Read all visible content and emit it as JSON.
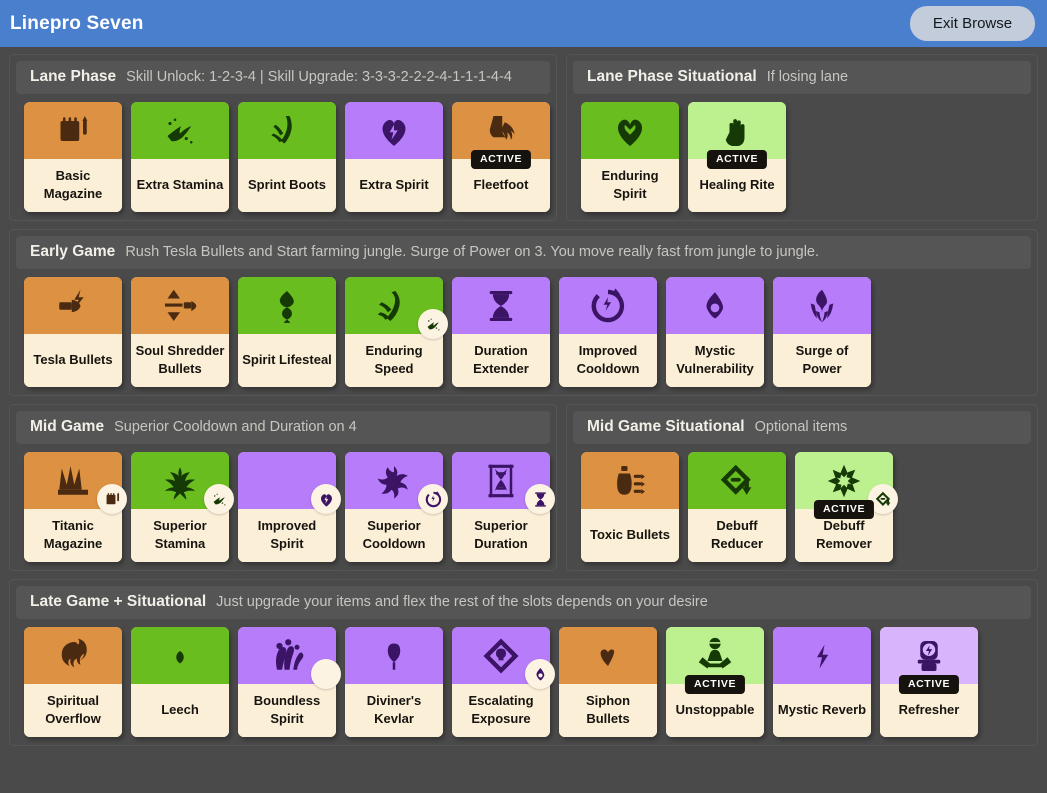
{
  "header": {
    "title": "Linepro Seven",
    "exit_label": "Exit Browse",
    "accent_color": "#4a7fce",
    "exit_button_color": "#c3ccda"
  },
  "colors": {
    "page_background": "#4a4a4a",
    "panel_background": "#4a4a4a",
    "panel_header": "#555555",
    "card_body": "#fcefd8",
    "weapon": "#dd9142",
    "vitality": "#69bd1e",
    "vitality_light": "#bdf18f",
    "spirit": "#b67cf9",
    "spirit_light": "#d8b4fd",
    "active_badge": "#16120d"
  },
  "active_badge_label": "ACTIVE",
  "sections": [
    {
      "id": "lane-phase",
      "title": "Lane Phase",
      "note": "Skill Unlock: 1-2-3-4 | Skill Upgrade: 3-3-3-2-2-2-4-1-1-1-4-4",
      "cards": [
        {
          "label": "Basic Magazine",
          "category": "weapon",
          "icon": "magazine-icon",
          "active": false,
          "tier_badge": null
        },
        {
          "label": "Extra Stamina",
          "category": "vitality",
          "icon": "stamina-icon",
          "active": false,
          "tier_badge": null
        },
        {
          "label": "Sprint Boots",
          "category": "vitality",
          "icon": "sprint-boots-icon",
          "active": false,
          "tier_badge": null
        },
        {
          "label": "Extra Spirit",
          "category": "spirit",
          "icon": "spirit-heart-icon",
          "active": false,
          "tier_badge": null
        },
        {
          "label": "Fleetfoot",
          "category": "weapon",
          "icon": "fleetfoot-boot-icon",
          "active": true,
          "tier_badge": null
        }
      ]
    },
    {
      "id": "lane-phase-situational",
      "title": "Lane Phase Situational",
      "note": "If losing lane",
      "cards": [
        {
          "label": "Enduring Spirit",
          "category": "vitality",
          "icon": "enduring-heart-icon",
          "active": false,
          "tier_badge": null
        },
        {
          "label": "Healing Rite",
          "category": "vitality_light",
          "icon": "healing-hand-icon",
          "active": true,
          "tier_badge": null
        }
      ]
    },
    {
      "id": "early-game",
      "title": "Early Game",
      "note": "Rush Tesla Bullets and Start farming jungle. Surge of Power on 3. You move really fast from jungle to jungle.",
      "cards": [
        {
          "label": "Tesla Bullets",
          "category": "weapon",
          "icon": "tesla-bullet-icon",
          "active": false,
          "tier_badge": null
        },
        {
          "label": "Soul Shredder Bullets",
          "category": "weapon",
          "icon": "soul-shredder-icon",
          "active": false,
          "tier_badge": null
        },
        {
          "label": "Spirit Lifesteal",
          "category": "vitality",
          "icon": "spirit-lifesteal-icon",
          "active": false,
          "tier_badge": null
        },
        {
          "label": "Enduring Speed",
          "category": "vitality",
          "icon": "enduring-speed-icon",
          "active": false,
          "tier_badge": "stamina-icon"
        },
        {
          "label": "Duration Extender",
          "category": "spirit",
          "icon": "hourglass-icon",
          "active": false,
          "tier_badge": null
        },
        {
          "label": "Improved Cooldown",
          "category": "spirit",
          "icon": "cooldown-icon",
          "active": false,
          "tier_badge": null
        },
        {
          "label": "Mystic Vulnerability",
          "category": "spirit",
          "icon": "mystic-vuln-icon",
          "active": false,
          "tier_badge": null
        },
        {
          "label": "Surge of Power",
          "category": "spirit",
          "icon": "surge-of-power-icon",
          "active": false,
          "tier_badge": null
        }
      ]
    },
    {
      "id": "mid-game",
      "title": "Mid Game",
      "note": "Superior Cooldown and Duration on 4",
      "cards": [
        {
          "label": "Titanic Magazine",
          "category": "weapon",
          "icon": "titanic-magazine-icon",
          "active": false,
          "tier_badge": "magazine-icon"
        },
        {
          "label": "Superior Stamina",
          "category": "vitality",
          "icon": "superior-stamina-icon",
          "active": false,
          "tier_badge": "stamina-icon"
        },
        {
          "label": "Improved Spirit",
          "category": "spirit",
          "icon": "improved-spirit-icon",
          "active": false,
          "tier_badge": "spirit-heart-icon"
        },
        {
          "label": "Superior Cooldown",
          "category": "spirit",
          "icon": "superior-cooldown-icon",
          "active": false,
          "tier_badge": "cooldown-icon"
        },
        {
          "label": "Superior Duration",
          "category": "spirit",
          "icon": "superior-duration-icon",
          "active": false,
          "tier_badge": "hourglass-icon"
        }
      ]
    },
    {
      "id": "mid-game-situational",
      "title": "Mid Game Situational",
      "note": "Optional items",
      "cards": [
        {
          "label": "Toxic Bullets",
          "category": "weapon",
          "icon": "toxic-bullets-icon",
          "active": false,
          "tier_badge": null
        },
        {
          "label": "Debuff Reducer",
          "category": "vitality",
          "icon": "debuff-reducer-icon",
          "active": false,
          "tier_badge": null
        },
        {
          "label": "Debuff Remover",
          "category": "vitality_light",
          "icon": "debuff-remover-icon",
          "active": true,
          "tier_badge": "debuff-reducer-icon"
        }
      ]
    },
    {
      "id": "late-game",
      "title": "Late Game + Situational",
      "note": "Just upgrade your items and flex the rest of the slots depends on your desire",
      "cards": [
        {
          "label": "Spiritual Overflow",
          "category": "weapon",
          "icon": "spiritual-overflow-icon",
          "active": false,
          "tier_badge": null
        },
        {
          "label": "Leech",
          "category": "vitality",
          "icon": "leech-icon",
          "active": false,
          "tier_badge": null
        },
        {
          "label": "Boundless Spirit",
          "category": "spirit",
          "icon": "boundless-spirit-icon",
          "active": false,
          "tier_badge": "improved-spirit-icon"
        },
        {
          "label": "Diviner's Kevlar",
          "category": "spirit",
          "icon": "diviners-kevlar-icon",
          "active": false,
          "tier_badge": null
        },
        {
          "label": "Escalating Exposure",
          "category": "spirit",
          "icon": "escalating-exposure-icon",
          "active": false,
          "tier_badge": "mystic-vuln-icon"
        },
        {
          "label": "Siphon Bullets",
          "category": "weapon",
          "icon": "siphon-bullets-icon",
          "active": false,
          "tier_badge": null
        },
        {
          "label": "Unstoppable",
          "category": "vitality_light",
          "icon": "unstoppable-icon",
          "active": true,
          "tier_badge": null
        },
        {
          "label": "Mystic Reverb",
          "category": "spirit",
          "icon": "mystic-reverb-icon",
          "active": false,
          "tier_badge": null
        },
        {
          "label": "Refresher",
          "category": "spirit_light",
          "icon": "refresher-icon",
          "active": true,
          "tier_badge": null
        }
      ]
    }
  ],
  "layout": {
    "rows": [
      [
        "lane-phase",
        "lane-phase-situational"
      ],
      [
        "early-game"
      ],
      [
        "mid-game",
        "mid-game-situational"
      ],
      [
        "late-game"
      ]
    ]
  }
}
